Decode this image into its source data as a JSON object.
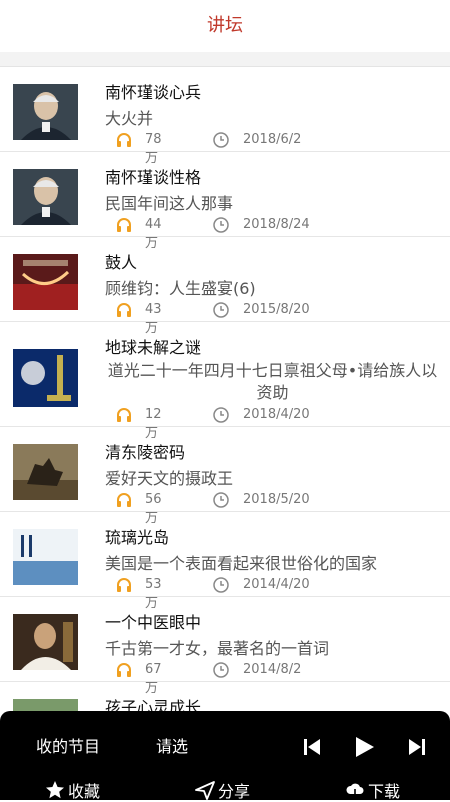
{
  "header": {
    "title": "讲坛"
  },
  "list": {
    "items": [
      {
        "title": "南怀瑾谈心兵",
        "subtitle": "大火并",
        "plays": "78万",
        "date": "2018/6/2"
      },
      {
        "title": "南怀瑾谈性格",
        "subtitle": "民国年间这人那事",
        "plays": "44万",
        "date": "2018/8/24"
      },
      {
        "title": "鼓人",
        "subtitle": "顾维钧：人生盛宴(6)",
        "plays": "43万",
        "date": "2015/8/20"
      },
      {
        "title": "地球未解之谜",
        "subtitle": "道光二十一年四月十七日禀祖父母•请给族人以资助",
        "plays": "12万",
        "date": "2018/4/20"
      },
      {
        "title": "清东陵密码",
        "subtitle": "爱好天文的摄政王",
        "plays": "56万",
        "date": "2018/5/20"
      },
      {
        "title": "琉璃光岛",
        "subtitle": "美国是一个表面看起来很世俗化的国家",
        "plays": "53万",
        "date": "2014/4/20"
      },
      {
        "title": "一个中医眼中",
        "subtitle": "千古第一才女，最著名的一首词",
        "plays": "67万",
        "date": "2014/8/2"
      },
      {
        "title": "孩子心灵成长"
      }
    ]
  },
  "player": {
    "left_text": "收的节目",
    "mid_text": "请选",
    "favorite_label": "收藏",
    "share_label": "分享",
    "download_label": "下载"
  },
  "colors": {
    "accent": "#c0392b",
    "headphone": "#f0a020",
    "player_bg": "#000000"
  }
}
